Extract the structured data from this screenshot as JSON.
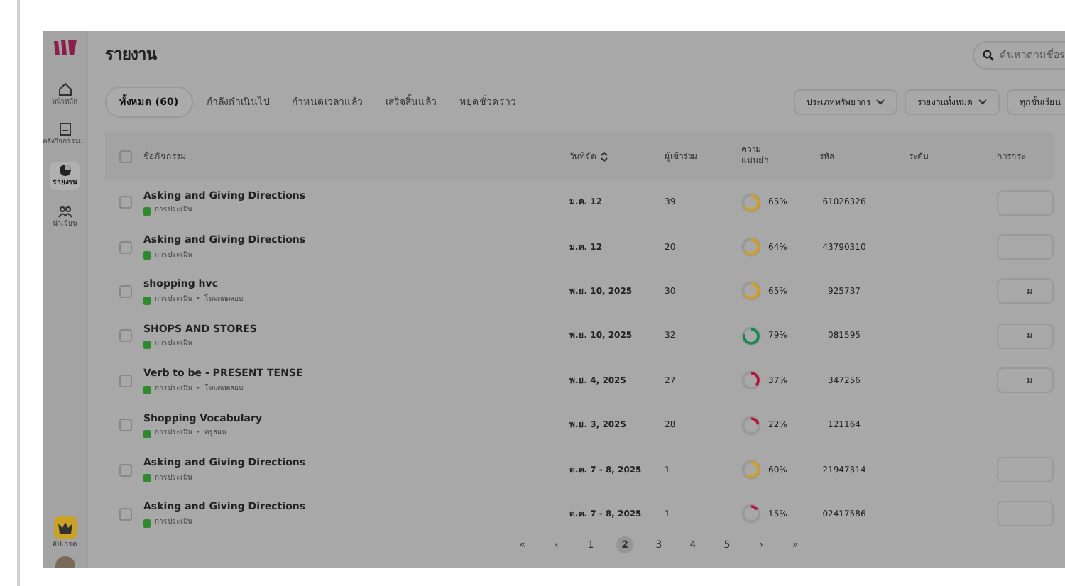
{
  "sidebar": {
    "items": [
      {
        "label": "หน้าหลัก",
        "selected": false
      },
      {
        "label": "คลังกิจกรรม...",
        "selected": false
      },
      {
        "label": "รายงาน",
        "selected": true
      },
      {
        "label": "นักเรียน",
        "selected": false
      }
    ],
    "upgrade": "อัปเกรด"
  },
  "header": {
    "title": "รายงาน",
    "search": {
      "placeholder": "ค้นหาตามชื่อร"
    }
  },
  "tabs": [
    {
      "label": "ทั้งหมด (60)",
      "selected": true
    },
    {
      "label": "กำลังดำเนินไป",
      "selected": false
    },
    {
      "label": "กำหนดเวลาแล้ว",
      "selected": false
    },
    {
      "label": "เสร็จสิ้นแล้ว",
      "selected": false
    },
    {
      "label": "หยุดชั่วคราว",
      "selected": false
    }
  ],
  "filters": [
    "ประเภททรัพยากร",
    "รายงานทั้งหมด",
    "ทุกชั้นเรียน"
  ],
  "table": {
    "select_all_checked": false,
    "columns": [
      "ชื่อกิจกรรม",
      "วันที่จัด",
      "ผู้เข้าร่วม",
      "ความแม่นยำ",
      "รหัส",
      "ระดับ",
      "การกระ"
    ],
    "rows": [
      {
        "name": "Asking and Giving Directions",
        "checked": false,
        "tags": [
          "การประเมิน"
        ],
        "date": "ม.ค. 12",
        "participants": "39",
        "accuracy": "65%",
        "level": 0.65,
        "color": "#d4a017",
        "code": "61026326",
        "has_action": true
      },
      {
        "name": "Asking and Giving Directions",
        "checked": false,
        "tags": [
          "การประเมิน"
        ],
        "date": "ม.ค. 12",
        "participants": "20",
        "accuracy": "64%",
        "level": 0.64,
        "color": "#d4a017",
        "code": "43790310",
        "has_action": true
      },
      {
        "name": "shopping hvc",
        "checked": false,
        "separator": "•",
        "tags": [
          "การประเมิน",
          "โหมดทดสอบ"
        ],
        "date": "พ.ย. 10, 2025",
        "participants": "30",
        "accuracy": "65%",
        "level": 0.65,
        "color": "#d4a017",
        "code": "925737",
        "has_action": true,
        "action": "ม"
      },
      {
        "name": "SHOPS AND STORES",
        "checked": false,
        "tags": [
          "การประเมิน"
        ],
        "date": "พ.ย. 10, 2025",
        "participants": "32",
        "accuracy": "79%",
        "level": 0.79,
        "color": "#138a4a",
        "code": "081595",
        "has_action": true,
        "action": "ม"
      },
      {
        "name": "Verb to be - PRESENT TENSE",
        "checked": false,
        "separator": "•",
        "tags": [
          "การประเมิน",
          "โหมดทดสอบ"
        ],
        "date": "พ.ย. 4, 2025",
        "participants": "27",
        "accuracy": "37%",
        "level": 0.37,
        "color": "#b5123a",
        "code": "347256",
        "has_action": true,
        "action": "ม"
      },
      {
        "name": "Shopping Vocabulary",
        "checked": false,
        "separator": "•",
        "tags": [
          "การประเมิน",
          "ครูสอน"
        ],
        "date": "พ.ย. 3, 2025",
        "participants": "28",
        "accuracy": "22%",
        "level": 0.22,
        "color": "#b5123a",
        "code": "121164",
        "has_action": false
      },
      {
        "name": "Asking and Giving Directions",
        "checked": false,
        "tags": [
          "การประเมิน"
        ],
        "date": "ต.ค. 7 - 8, 2025",
        "participants": "1",
        "accuracy": "60%",
        "level": 0.6,
        "color": "#d4a017",
        "code": "21947314",
        "has_action": true
      },
      {
        "name": "Asking and Giving Directions",
        "checked": false,
        "tags": [
          "การประเมิน"
        ],
        "date": "ต.ค. 7 - 8, 2025",
        "participants": "1",
        "accuracy": "15%",
        "level": 0.15,
        "color": "#b5123a",
        "code": "02417586",
        "has_action": true
      }
    ]
  },
  "pagination": [
    {
      "label": "«",
      "selected": false
    },
    {
      "label": "‹",
      "selected": false
    },
    {
      "label": "1",
      "selected": false
    },
    {
      "label": "2",
      "selected": true
    },
    {
      "label": "3",
      "selected": false
    },
    {
      "label": "4",
      "selected": false
    },
    {
      "label": "5",
      "selected": false
    },
    {
      "label": "›",
      "selected": false
    },
    {
      "label": "»",
      "selected": false
    }
  ]
}
